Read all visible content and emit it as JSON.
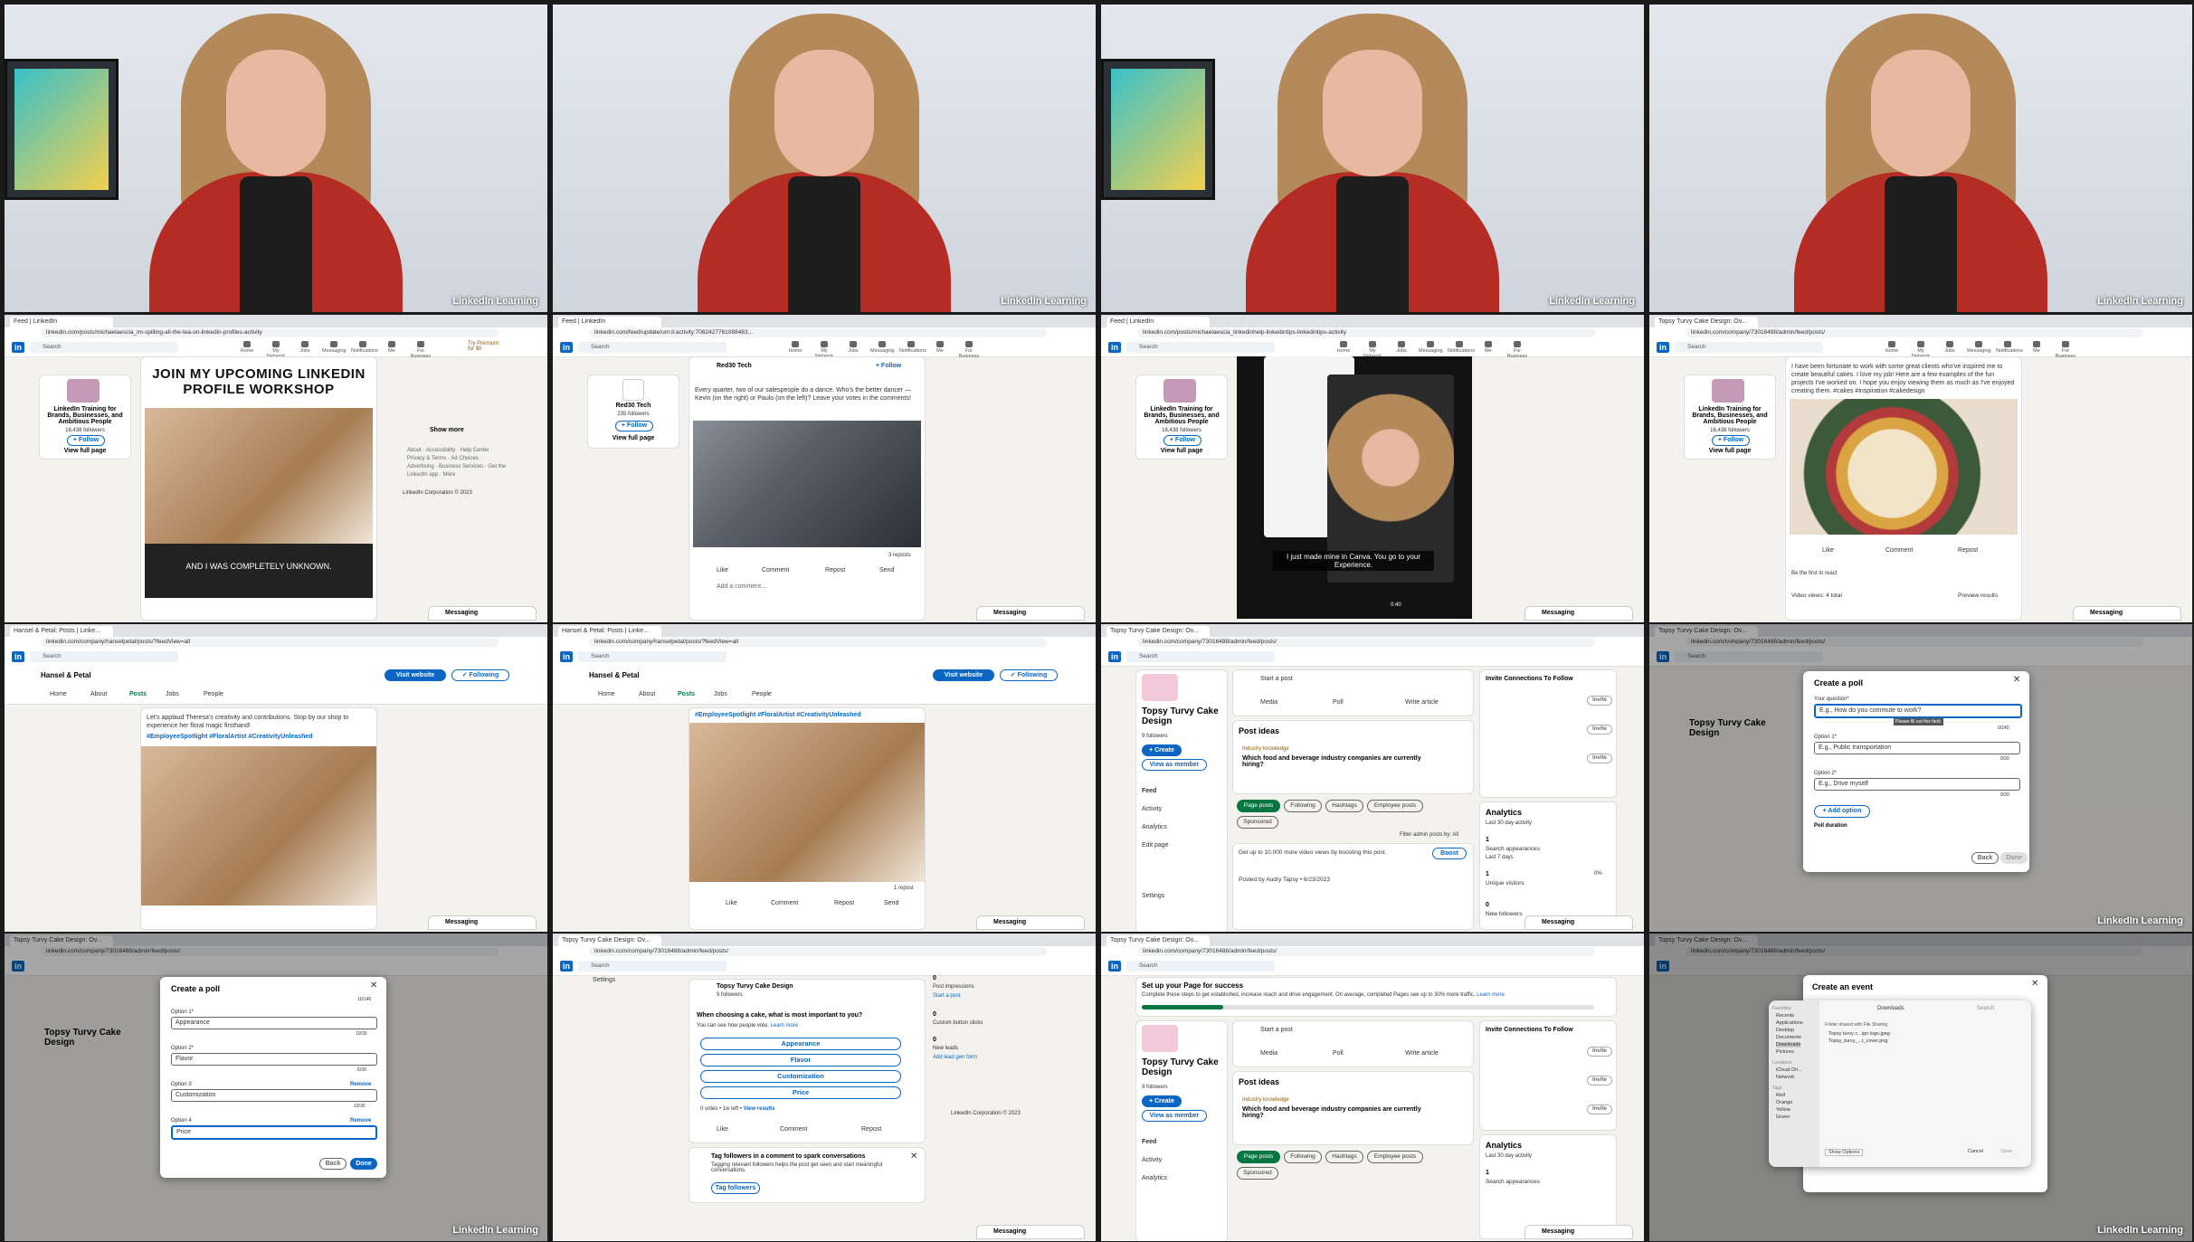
{
  "brand": "LinkedIn Learning",
  "colors": {
    "linkedin_blue": "#0a66c2",
    "jacket_red": "#b52c24",
    "green": "#057642"
  },
  "browser": {
    "tab_feed": "Feed | LinkedIn",
    "tab_hansel": "Hansel & Petal: Posts | Linke...",
    "tab_topsy": "Topsy Turvy Cake Design: Ov...",
    "url_feed1": "linkedin.com/posts/michaelaescia_im-spilling-all-the-tea-on-linkedin-profiles-activity",
    "url_feed2": "linkedin.com/feed/update/urn:li:activity:7082427761088483...",
    "url_feed3": "linkedin.com/posts/michaelaescia_linkedinhelp-linkedintips-linkedintips-activity",
    "url_topsy": "linkedin.com/company/73016488/admin/feed/posts/",
    "url_hansel": "linkedin.com/company/hanselpetal/posts/?feedView=all"
  },
  "nav": {
    "search": "Search",
    "items": [
      "Home",
      "My Network",
      "Jobs",
      "Messaging",
      "Notifications",
      "Me",
      "For Business"
    ],
    "premium": "Try Premium for $0"
  },
  "messaging": "Messaging",
  "tile5": {
    "company": "LinkedIn Training for Brands, Businesses, and Ambitious People",
    "followers": "16,438 followers",
    "follow": "+ Follow",
    "view_page": "View full page",
    "headline": "JOIN MY UPCOMING LINKEDIN PROFILE WORKSHOP",
    "caption": "AND I WAS COMPLETELY UNKNOWN.",
    "show_more": "Show more",
    "footer": [
      "About",
      "Accessibility",
      "Help Center",
      "Privacy & Terms",
      "Ad Choices",
      "Advertising",
      "Business Services",
      "Get the LinkedIn app",
      "More"
    ],
    "copyright": "LinkedIn Corporation © 2023"
  },
  "tile6": {
    "company": "Red30 Tech",
    "followers": "235 followers",
    "follow": "+ Follow",
    "view_page": "View full page",
    "post_text": "Every quarter, two of our salespeople do a dance. Who's the better dancer — Kevin (on the right) or Paulo (on the left)? Leave your votes in the comments!",
    "reposts": "3 reposts",
    "actions": [
      "Like",
      "Comment",
      "Repost",
      "Send"
    ],
    "add_comment": "Add a comment…"
  },
  "tile7": {
    "company": "LinkedIn Training for Brands, Businesses, and Ambitious People",
    "followers": "16,438 followers",
    "follow": "+ Follow",
    "view_page": "View full page",
    "caption": "I just made mine in Canva. You go to your Experience.",
    "time": "0:40"
  },
  "tile8": {
    "post_text": "I have been fortunate to work with some great clients who've inspired me to create beautiful cakes. I love my job! Here are a few examples of the fun projects I've worked on. I hope you enjoy viewing them as much as I've enjoyed creating them. #cakes #inspiration #cakedesign",
    "company": "LinkedIn Training for Brands, Businesses, and Ambitious People",
    "followers": "16,438 followers",
    "follow": "+ Follow",
    "view_page": "View full page",
    "actions": [
      "Like",
      "Comment",
      "Repost"
    ],
    "first_react": "Be the first to react",
    "views": "Video views: 4 total",
    "preview": "Preview results"
  },
  "hansel": {
    "name": "Hansel & Petal",
    "tabs": [
      "Home",
      "About",
      "Posts",
      "Jobs",
      "People"
    ],
    "visit": "Visit website",
    "following": "✓ Following",
    "post_text": "Let's applaud Theresa's creativity and contributions. Stop by our shop to experience her floral magic firsthand!",
    "hashtags": "#EmployeeSpotlight #FloralArtist #CreativityUnleashed",
    "reposts": "1 repost",
    "actions": [
      "Like",
      "Comment",
      "Repost",
      "Send"
    ]
  },
  "topsy": {
    "name": "Topsy Turvy Cake Design",
    "followers": "9 followers",
    "create": "+ Create",
    "view_member": "View as member",
    "menu": [
      "Feed",
      "Activity",
      "Analytics",
      "Edit page",
      "Settings"
    ],
    "start_post": "Start a post",
    "media": "Media",
    "poll": "Poll",
    "write_article": "Write article",
    "post_ideas": "Post ideas",
    "industry": "Industry knowledge",
    "idea_question": "Which food and beverage industry companies are currently hiring?",
    "filters": [
      "Page posts",
      "Following",
      "Hashtags",
      "Employee posts",
      "Sponsored"
    ],
    "filter_label": "Filter admin posts by:",
    "filter_val": "All",
    "boost_text": "Get up to 10,000 more video views by boosting this post.",
    "boost": "Boost",
    "posted_by": "Posted by Audry Tapsy",
    "posted_date": "6/23/2023",
    "invite": "Invite Connections To Follow",
    "invite_btn": "Invite",
    "analytics": "Analytics",
    "last30": "Last 30 day activity",
    "stat_search": "Search appearances",
    "last7": "Last 7 days",
    "stat_visitors": "Unique visitors",
    "stat_followers": "New followers",
    "val_1": "1",
    "val_0": "0",
    "pct_0": "0%"
  },
  "poll": {
    "title": "Create a poll",
    "question_label": "Your question*",
    "question_ph": "E.g., How do you commute to work?",
    "please_fill": "Please fill out this field.",
    "count_q": "0/140",
    "opt1_label": "Option 1*",
    "opt1_ph": "E.g., Public transportation",
    "opt2_label": "Option 2*",
    "opt2_ph": "E.g., Drive myself",
    "count_o": "0/30",
    "add_option": "+ Add option",
    "duration": "Poll duration",
    "back": "Back",
    "done": "Done",
    "count_top": "10/140",
    "filled": [
      {
        "label": "Option 1*",
        "value": "Appearance",
        "count": "10/30"
      },
      {
        "label": "Option 2*",
        "value": "Flavor",
        "count": "6/30"
      },
      {
        "label": "Option 3",
        "value": "Customization",
        "count": "13/30",
        "remove": "Remove"
      },
      {
        "label": "Option 4",
        "value": "Price",
        "count": "5/30",
        "remove": "Remove"
      }
    ]
  },
  "pollpost": {
    "company": "Topsy Turvy Cake Design",
    "followers": "9 followers",
    "question": "When choosing a cake, what is most important to you?",
    "note": "You can see how people vote.",
    "learn_more": "Learn more",
    "options": [
      "Appearance",
      "Flavor",
      "Customization",
      "Price"
    ],
    "votes": "0 votes",
    "left": "1w left",
    "view_results": "View results",
    "actions": [
      "Like",
      "Comment",
      "Repost"
    ],
    "tag_title": "Tag followers in a comment to spark conversations",
    "tag_text": "Tagging relevant followers helps the post get seen and start meaningful conversations.",
    "tag_btn": "Tag followers",
    "impressions": "Post impressions",
    "start_post": "Start a post",
    "clicks": "Custom button clicks",
    "leads": "New leads",
    "lead_form": "Add lead gen form",
    "settings": "Settings",
    "val_0": "0"
  },
  "setup": {
    "title": "Set up your Page for success",
    "text": "Complete these steps to get established, increase reach and drive engagement. On average, completed Pages see up to 30% more traffic.",
    "learn": "Learn more"
  },
  "event": {
    "title": "Create an event",
    "dialog_folder": "Downloads",
    "files": [
      "Topsy turvy c...ign logo.jpeg",
      "Topsy_turvy_...t_cover.png"
    ],
    "sidebar": [
      "Favorites",
      "Recents",
      "Applications",
      "Desktop",
      "Documents",
      "Downloads",
      "Pictures",
      "Locations",
      "iCloud Dri...",
      "Network",
      "Tags",
      "Red",
      "Orange",
      "Yellow",
      "Green"
    ],
    "shared": "Folder shared with File Sharing",
    "show_options": "Show Options",
    "cancel": "Cancel",
    "open": "Open",
    "search": "Search"
  }
}
